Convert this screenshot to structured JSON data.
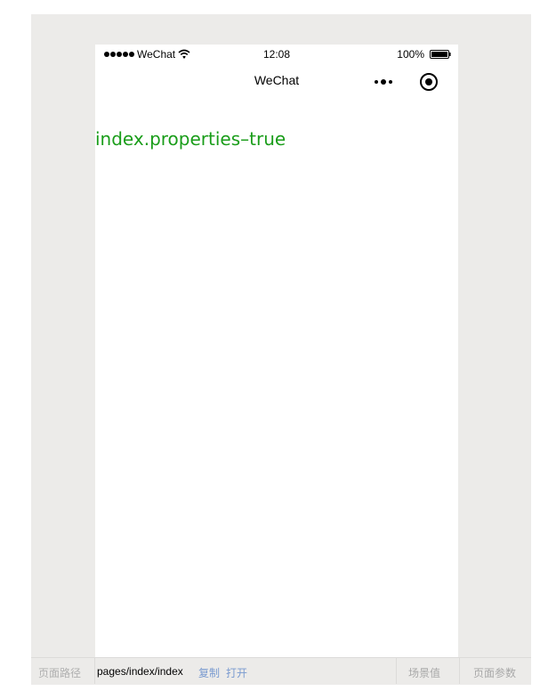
{
  "status_bar": {
    "carrier": "WeChat",
    "time": "12:08",
    "battery": "100%"
  },
  "nav_bar": {
    "title": "WeChat"
  },
  "content": {
    "text": "index.properties–true"
  },
  "bottom_bar": {
    "page_path_label": "页面路径",
    "page_path_value": "pages/index/index",
    "copy_label": "复制",
    "open_label": "打开",
    "scene_label": "场景值",
    "params_label": "页面参数"
  },
  "colors": {
    "content_text": "#1a9d1a",
    "link": "#7a9bd0",
    "background": "#ecebe9"
  },
  "icons": [
    "signal-dots-icon",
    "wifi-icon",
    "battery-icon",
    "more-dots-icon",
    "record-icon"
  ]
}
